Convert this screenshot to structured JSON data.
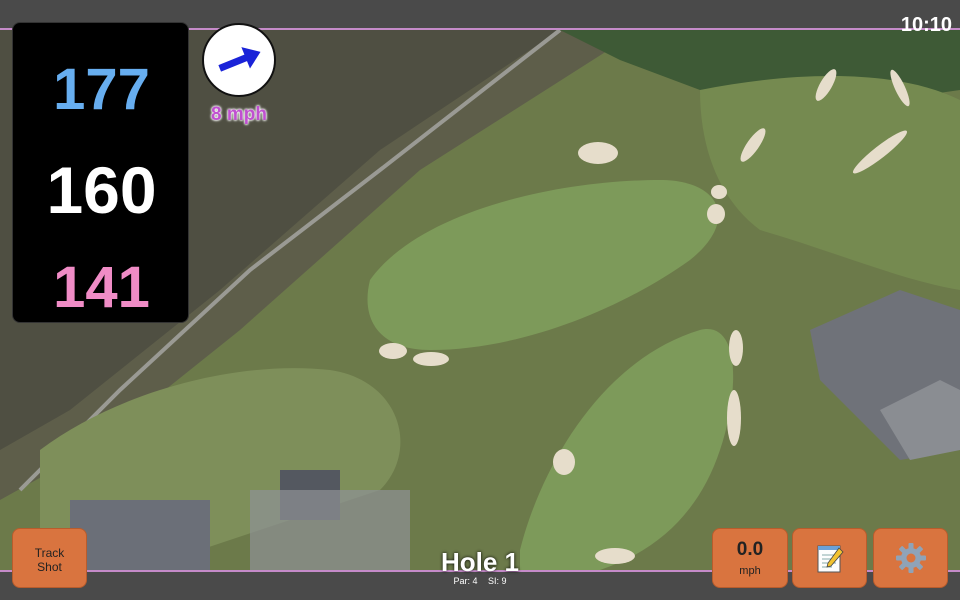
{
  "status": {
    "time": "10:10"
  },
  "distances": {
    "back": "177",
    "middle": "160",
    "front": "141"
  },
  "wind": {
    "speed": "8 mph",
    "icon": "arrow-right-icon"
  },
  "hole": {
    "title": "Hole 1",
    "par": "Par: 4",
    "si": "SI: 9"
  },
  "buttons": {
    "track_shot": [
      "Track",
      "Shot"
    ],
    "speed_value": "0.0",
    "speed_unit": "mph",
    "notes_icon": "notepad-icon",
    "settings_icon": "gear-icon"
  },
  "colors": {
    "back": "#67aef0",
    "middle": "#ffffff",
    "front": "#f08cc6",
    "button": "#d9743f",
    "accent": "#c58bc9"
  }
}
